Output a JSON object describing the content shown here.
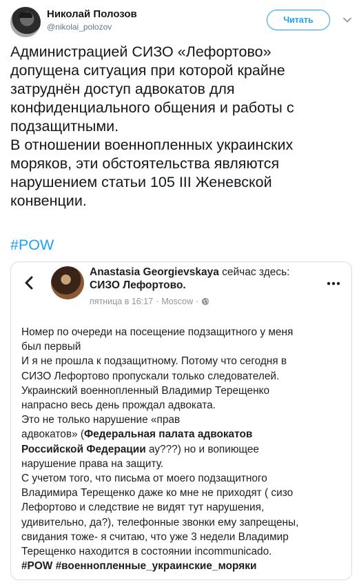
{
  "tweet": {
    "author_name": "Николай Полозов",
    "author_handle": "@nikolai_polozov",
    "follow_label": "Читать",
    "text_paragraphs": [
      "Администрацией СИЗО «Лефортово»\nдопущена ситуация при которой крайне\nзатруднён доступ адвокатов для\nконфиденциального общения и работы с\nподзащитными.",
      "В отношении военнопленных украинских\nморяков, эти обстоятельства являются\nнарушением статьи 105 III Женевской\nконвенции."
    ],
    "hashtag": "#POW",
    "accent_color": "#1da1f2"
  },
  "fb_post": {
    "author": "Anastasia Georgievskaya",
    "checkin_text": " сейчас здесь:",
    "place": "СИЗО Лефортово.",
    "time": "пятница в 16:17",
    "separator": "·",
    "location": "Moscow",
    "lines": [
      {
        "text": "Номер по очереди на посещение подзащитного у меня"
      },
      {
        "text": "был первый"
      },
      {
        "text": "И я не прошла к подзащитному. Потому что сегодня в"
      },
      {
        "text": "СИЗО Лефортово пропускали только следователей."
      },
      {
        "text": "Украинский военнопленный Владимир Терещенко"
      },
      {
        "text": "напрасно весь день прождал адвоката."
      },
      {
        "text": "Это не только нарушение «прав"
      },
      {
        "pre": "адвокатов» (",
        "bold": "Федеральная палата адвокатов",
        "post": ""
      },
      {
        "pre": "",
        "bold": "Российской Федерации",
        "post": " ау???) но и вопиющее"
      },
      {
        "text": "нарушение права на защиту."
      },
      {
        "text": "С учетом того, что письма от моего подзащитного"
      },
      {
        "text": "Владимира Терещенко даже ко мне не приходят ( сизо"
      },
      {
        "text": "Лефортово и следствие не видят тут нарушения,"
      },
      {
        "text": "удивительно, да?), телефонные звонки ему запрещены,"
      },
      {
        "text": "свидания тоже- я считаю, что уже 3 недели Владимир"
      },
      {
        "text": "Терещенко находится в состоянии incommunicado."
      },
      {
        "pre": "",
        "bold": "#POW #военнопленные_украинские_моряки",
        "post": ""
      }
    ]
  }
}
